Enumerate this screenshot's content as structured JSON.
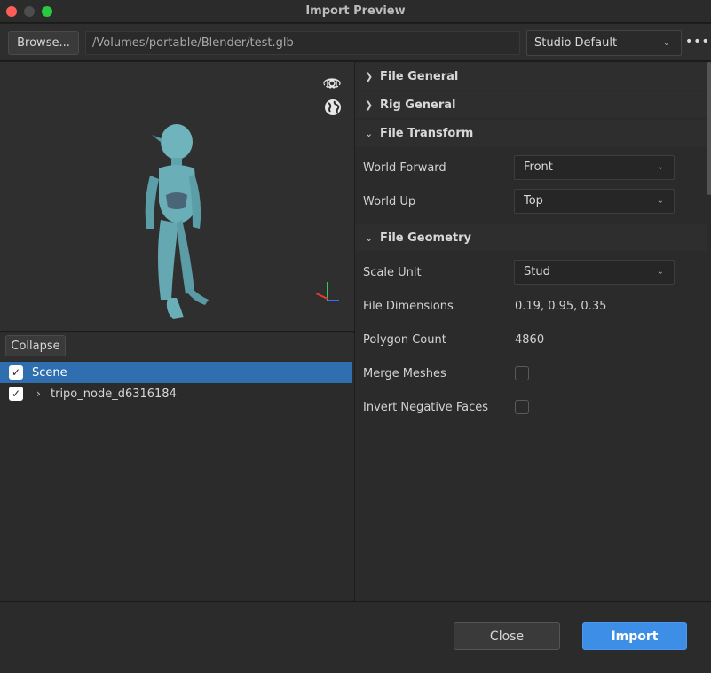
{
  "window": {
    "title": "Import Preview"
  },
  "toolbar": {
    "browse_label": "Browse...",
    "file_path": "/Volumes/portable/Blender/test.glb",
    "preset_value": "Studio Default",
    "more_label": "•••"
  },
  "viewport": {
    "rotate_icon": "camera-rotate-icon",
    "globe_icon": "globe-icon"
  },
  "tree": {
    "collapse_label": "Collapse",
    "items": [
      {
        "label": "Scene",
        "checked": true,
        "selected": true
      },
      {
        "label": "tripo_node_d6316184",
        "checked": true,
        "selected": false
      }
    ]
  },
  "properties": {
    "sections": {
      "file_general": "File General",
      "rig_general": "Rig General",
      "file_transform": "File Transform",
      "file_geometry": "File Geometry"
    },
    "world_forward": {
      "label": "World Forward",
      "value": "Front"
    },
    "world_up": {
      "label": "World Up",
      "value": "Top"
    },
    "scale_unit": {
      "label": "Scale Unit",
      "value": "Stud"
    },
    "file_dimensions": {
      "label": "File Dimensions",
      "value": "0.19, 0.95, 0.35"
    },
    "polygon_count": {
      "label": "Polygon Count",
      "value": "4860"
    },
    "merge_meshes": {
      "label": "Merge Meshes",
      "checked": false
    },
    "invert_negative_faces": {
      "label": "Invert Negative Faces",
      "checked": false
    }
  },
  "footer": {
    "close_label": "Close",
    "import_label": "Import"
  },
  "colors": {
    "accent": "#3d8ee6",
    "selection": "#2f6fb0",
    "model_tint": "#6fb3bd"
  }
}
